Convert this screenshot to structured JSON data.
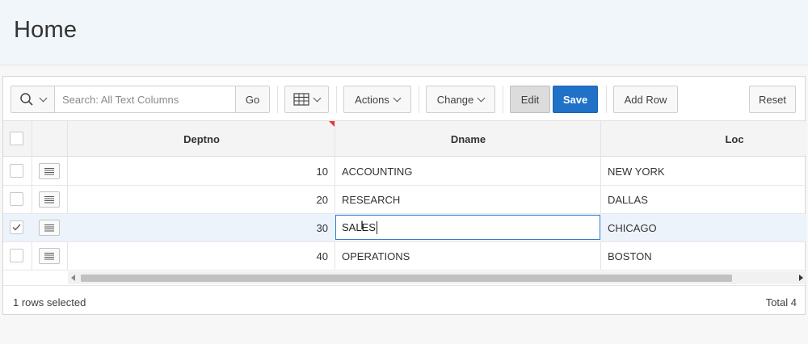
{
  "page": {
    "title": "Home"
  },
  "toolbar": {
    "search_placeholder": "Search: All Text Columns",
    "go_label": "Go",
    "actions_label": "Actions",
    "change_label": "Change",
    "edit_label": "Edit",
    "save_label": "Save",
    "add_row_label": "Add Row",
    "reset_label": "Reset",
    "colors": {
      "save_bg": "#1f72c8",
      "edit_bg": "#dcdcdc"
    }
  },
  "grid": {
    "columns": [
      "Deptno",
      "Dname",
      "Loc"
    ],
    "rows": [
      {
        "deptno": "10",
        "dname": "ACCOUNTING",
        "loc": "NEW YORK",
        "selected": false
      },
      {
        "deptno": "20",
        "dname": "RESEARCH",
        "loc": "DALLAS",
        "selected": false
      },
      {
        "deptno": "30",
        "dname": "SALES",
        "loc": "CHICAGO",
        "selected": true
      },
      {
        "deptno": "40",
        "dname": "OPERATIONS",
        "loc": "BOSTON",
        "selected": false
      }
    ]
  },
  "footer": {
    "selection_text": "1 rows selected",
    "total_text": "Total 4"
  }
}
